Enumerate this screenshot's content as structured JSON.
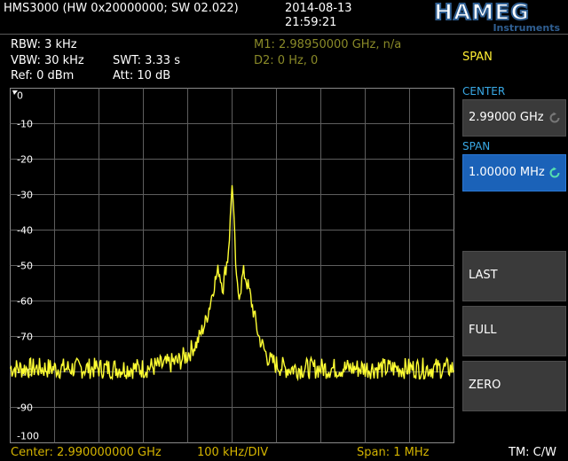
{
  "header": {
    "model": "HMS3000 (HW 0x20000000; SW 02.022)",
    "date": "2014-08-13",
    "time": "21:59:21",
    "logo_text": "HAMEG",
    "logo_sub": "Instruments"
  },
  "settings": {
    "rbw": "RBW: 3 kHz",
    "vbw": "VBW: 30 kHz",
    "swt": "SWT: 3.33 s",
    "ref": "Ref: 0 dBm",
    "att": "Att: 10 dB"
  },
  "markers": {
    "m1": "M1: 2.98950000 GHz, n/a",
    "d2": "D2: 0 Hz, 0"
  },
  "menu": {
    "title": "SPAN",
    "center_label": "CENTER",
    "center_value": "2.99000 GHz",
    "span_label": "SPAN",
    "span_value": "1.00000 MHz",
    "last": "LAST",
    "full": "FULL",
    "zero": "ZERO"
  },
  "footer": {
    "center": "Center: 2.990000000 GHz",
    "div": "100 kHz/DIV",
    "span": "Span: 1 MHz",
    "tm": "TM: C/W"
  },
  "colors": {
    "trace": "#ffff33",
    "grid": "#5e5e5e",
    "marker_text": "#8a8a28",
    "footer_text": "#d4b400",
    "accent": "#39a9e6",
    "span_box": "#1b62b8"
  },
  "chart_data": {
    "type": "line",
    "x_unit": "MHz offset from center",
    "y_ticks": [
      "0",
      "-10",
      "-20",
      "-30",
      "-40",
      "-50",
      "-60",
      "-70",
      "-80",
      "-90",
      "-100"
    ],
    "ylim": [
      -100,
      0
    ],
    "xlim": [
      -0.5,
      0.5
    ],
    "grid": true,
    "series": [
      {
        "x": [
          -0.5,
          -0.45,
          -0.4,
          -0.35,
          -0.3,
          -0.25,
          -0.2,
          -0.15,
          -0.12,
          -0.1,
          -0.08,
          -0.06,
          -0.05,
          -0.04,
          -0.03,
          -0.025,
          -0.02,
          -0.015,
          -0.01,
          -0.005,
          0.0,
          0.005,
          0.01,
          0.015,
          0.02,
          0.025,
          0.03,
          0.04,
          0.05,
          0.06,
          0.08,
          0.1,
          0.12,
          0.15,
          0.2,
          0.25,
          0.3,
          0.35,
          0.4,
          0.45,
          0.5
        ],
        "values": [
          -79,
          -79,
          -79,
          -79,
          -79,
          -79,
          -79,
          -78,
          -77,
          -75,
          -72,
          -66,
          -61,
          -55,
          -51,
          -54,
          -56,
          -51,
          -48,
          -40,
          -26,
          -40,
          -55,
          -58,
          -56,
          -52,
          -53,
          -58,
          -64,
          -70,
          -76,
          -78,
          -79,
          -79,
          -79,
          -79,
          -79,
          -79,
          -79,
          -79,
          -79
        ]
      }
    ]
  }
}
